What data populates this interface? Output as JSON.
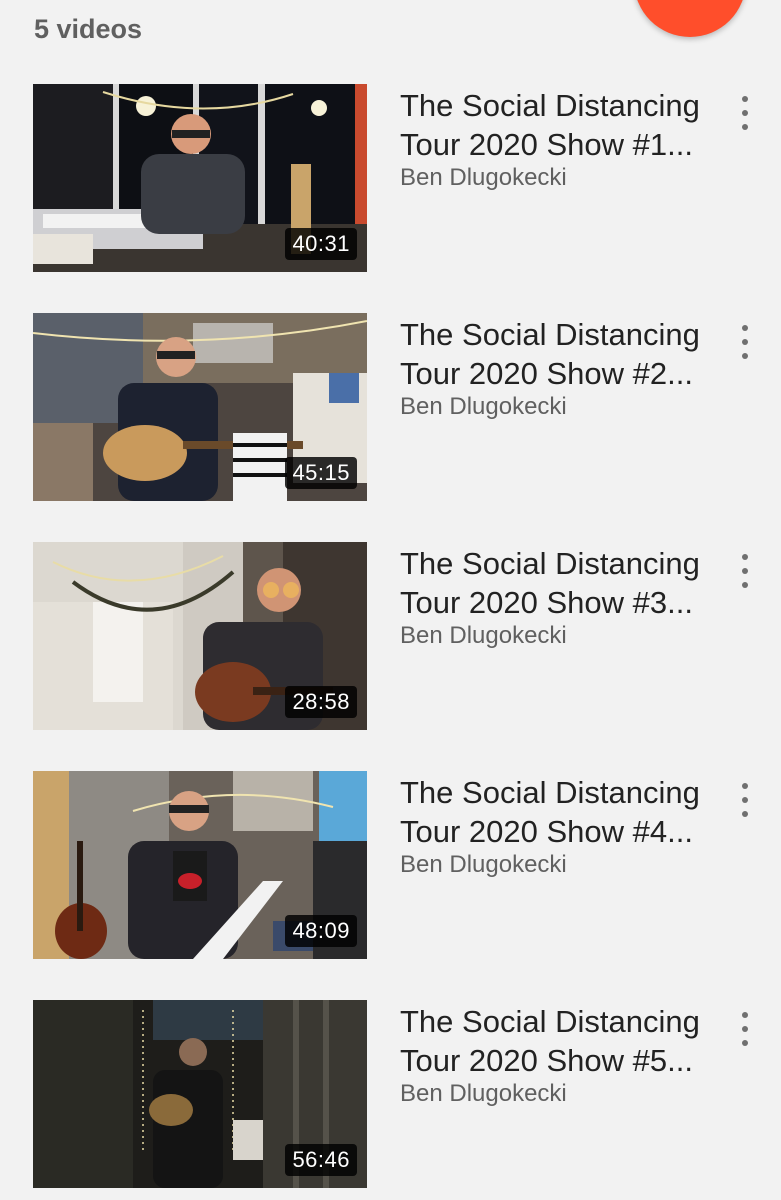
{
  "header": {
    "video_count": "5 videos"
  },
  "colors": {
    "accent": "#ff4e2b",
    "background": "#f2f2f2",
    "title_text": "#222222",
    "meta_text": "#606060"
  },
  "videos": [
    {
      "title_line1": "The Social Distancing",
      "title_line2": "Tour 2020 Show #1...",
      "channel": "Ben Dlugokecki",
      "duration": "40:31"
    },
    {
      "title_line1": "The Social Distancing",
      "title_line2": "Tour 2020 Show #2...",
      "channel": "Ben Dlugokecki",
      "duration": "45:15"
    },
    {
      "title_line1": "The Social Distancing",
      "title_line2": "Tour 2020 Show #3...",
      "channel": "Ben Dlugokecki",
      "duration": "28:58"
    },
    {
      "title_line1": "The Social Distancing",
      "title_line2": "Tour 2020 Show #4...",
      "channel": "Ben Dlugokecki",
      "duration": "48:09"
    },
    {
      "title_line1": "The Social Distancing",
      "title_line2": "Tour 2020 Show #5...",
      "channel": "Ben Dlugokecki",
      "duration": "56:46"
    }
  ]
}
